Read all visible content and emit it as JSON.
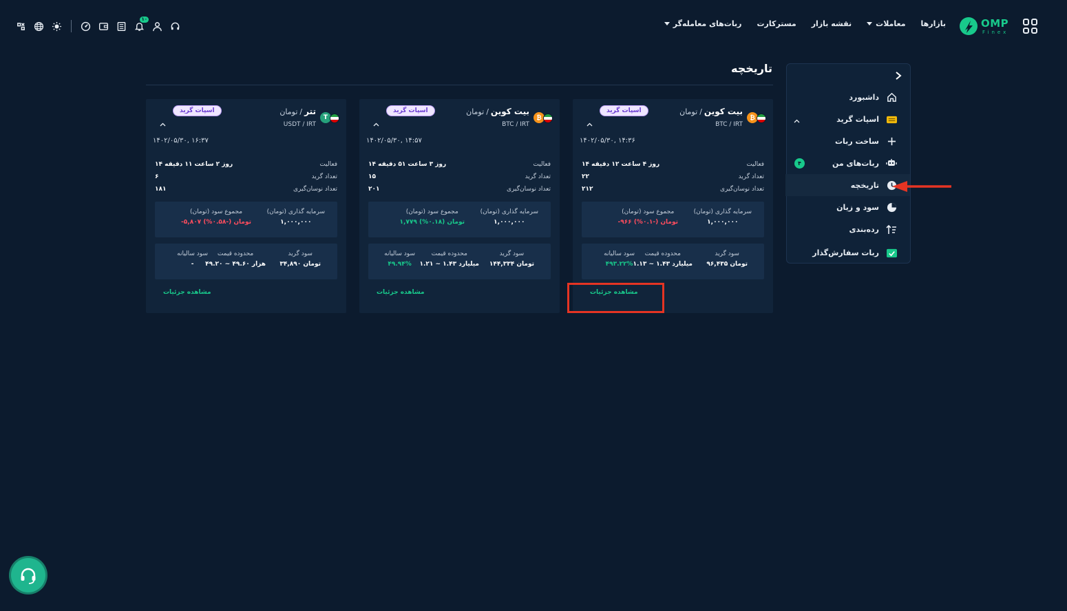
{
  "header": {
    "brand_name": "OMP",
    "brand_sub": "Finex",
    "nav": [
      {
        "label": "بازارها",
        "dropdown": false
      },
      {
        "label": "معاملات",
        "dropdown": true
      },
      {
        "label": "نقشه بازار",
        "dropdown": false
      },
      {
        "label": "مسترکارت",
        "dropdown": false
      },
      {
        "label": "ربات‌های معامله‌گر",
        "dropdown": true
      }
    ],
    "tools": [
      "support-icon",
      "user-icon",
      "bell-icon",
      "orders-icon",
      "wallet-icon",
      "dashboard-icon",
      "theme-icon",
      "language-icon",
      "settings-icon"
    ],
    "notification_count": "۱۰"
  },
  "sidebar": {
    "items": [
      {
        "label": "داشبورد",
        "icon": "home-icon"
      },
      {
        "label": "اسپات گرید",
        "icon": "grid-bot-icon"
      },
      {
        "label": "ساخت ربات",
        "icon": "plus-icon"
      },
      {
        "label": "ربات‌های من",
        "icon": "robot-icon",
        "count": "۴"
      },
      {
        "label": "تاریخچه",
        "icon": "clock-icon",
        "active": true
      },
      {
        "label": "سود و زیان",
        "icon": "pie-chart-icon"
      },
      {
        "label": "رده‌بندی",
        "icon": "ranking-icon"
      },
      {
        "label": "ربات سفارش‌گذار",
        "icon": "order-bot-icon"
      }
    ]
  },
  "page": {
    "title": "تاریخچه"
  },
  "labels": {
    "activity": "فعالیت",
    "grid_count": "تعداد گرید",
    "swing_count": "تعداد نوسان‌گیری",
    "investment": "سرمایه گذاری (تومان)",
    "total_profit": "مجموع سود (تومان)",
    "grid_profit": "سود گرید",
    "price_range": "محدوده قیمت",
    "annual_profit": "سود سالیانه",
    "details": "مشاهده جزئیات"
  },
  "cards": [
    {
      "coin": "btc",
      "coin_glyph": "₿",
      "base": "بیت کوین",
      "quote": "تومان",
      "symbol": "BTC / IRT",
      "tag": "اسپات گرید",
      "date": "۱۴۰۲/۰۵/۳۰, ۱۴:۳۶",
      "activity": "۱۴ روز ۴ ساعت ۱۲ دقیقه",
      "grid_count": "۲۲",
      "swing_count": "۲۱۲",
      "investment": "۱,۰۰۰,۰۰۰",
      "total_profit": "-۹۶۶ تومان (-۰.۱%)",
      "total_profit_sign": "neg",
      "grid_profit": "۹۶,۴۳۵ تومان",
      "price_range": "۱.۱۳ ~ ۱.۴۳ میلیارد",
      "annual_profit": "۴۹۳.۲۲%",
      "annual_sign": "pos"
    },
    {
      "coin": "btc",
      "coin_glyph": "₿",
      "base": "بیت کوین",
      "quote": "تومان",
      "symbol": "BTC / IRT",
      "tag": "اسپات گرید",
      "date": "۱۴۰۲/۰۵/۳۰, ۱۴:۵۷",
      "activity": "۱۴ روز ۳ ساعت ۵۱ دقیقه",
      "grid_count": "۱۵",
      "swing_count": "۲۰۱",
      "investment": "۱,۰۰۰,۰۰۰",
      "total_profit": "۱,۷۷۹ تومان (۰.۱۸%)",
      "total_profit_sign": "pos",
      "grid_profit": "۱۴۴,۳۳۴ تومان",
      "price_range": "۱.۲۱ ~ ۱.۴۳ میلیارد",
      "annual_profit": "۴۹.۹۴%",
      "annual_sign": "pos"
    },
    {
      "coin": "usdt",
      "coin_glyph": "T",
      "base": "تتر",
      "quote": "تومان",
      "symbol": "USDT / IRT",
      "tag": "اسپات گرید",
      "date": "۱۴۰۲/۰۵/۳۰, ۱۶:۳۷",
      "activity": "۱۴ روز ۲ ساعت ۱۱ دقیقه",
      "grid_count": "۶",
      "swing_count": "۱۸۱",
      "investment": "۱,۰۰۰,۰۰۰",
      "total_profit": "-۵,۸۰۷ تومان (-۰.۵۸%)",
      "total_profit_sign": "neg",
      "grid_profit": "۳۴,۸۹۰ تومان",
      "price_range": "۴۹.۲۰ ~ ۴۹.۶۰ هزار",
      "annual_profit": "-",
      "annual_sign": "none"
    }
  ],
  "colors": {
    "background": "#0c1b2e",
    "card": "#11243a",
    "accent": "#18c98b",
    "negative": "#ff4d5e",
    "tag_bg": "#efe6ff",
    "tag_text": "#6a3bd1",
    "annotation_red": "#e53423"
  }
}
